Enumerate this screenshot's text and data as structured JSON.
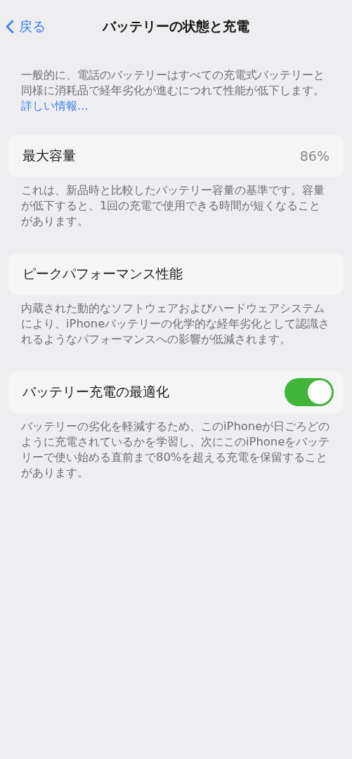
{
  "nav": {
    "back": "戻る",
    "title": "バッテリーの状態と充電"
  },
  "intro": {
    "text": "一般的に、電話のバッテリーはすべての充電式バッテリーと同様に消耗品で経年劣化が進むにつれて性能が低下します。",
    "link": "詳しい情報..."
  },
  "sections": [
    {
      "kind": "value",
      "label": "最大容量",
      "value": "86%",
      "footer": "これは、新品時と比較したバッテリー容量の基準です。容量が低下すると、1回の充電で使用できる時間が短くなることがあります。"
    },
    {
      "kind": "plain",
      "label": "ピークパフォーマンス性能",
      "footer": "内蔵された動的なソフトウェアおよびハードウェアシステムにより、iPhoneバッテリーの化学的な経年劣化として認識されるようなパフォーマンスへの影響が低減されます。"
    },
    {
      "kind": "toggle",
      "label": "バッテリー充電の最適化",
      "on": true,
      "footer": "バッテリーの劣化を軽減するため、このiPhoneが日ごろどのように充電されているかを学習し、次にこのiPhoneをバッテリーで使い始める直前まで80%を超える充電を保留することがあります。"
    }
  ]
}
